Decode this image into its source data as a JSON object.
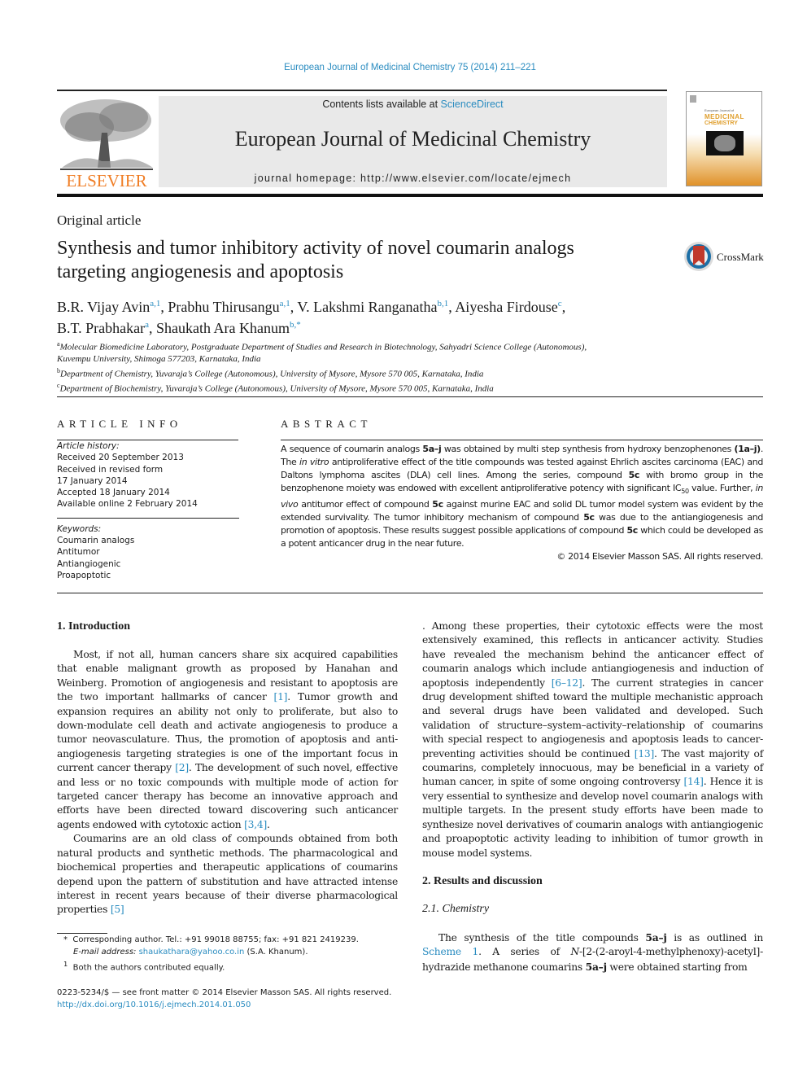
{
  "header": {
    "journal_ref": "European Journal of Medicinal Chemistry 75 (2014) 211–221",
    "contents_prefix": "Contents lists available at ",
    "contents_link": "ScienceDirect",
    "journal_title": "European Journal of Medicinal Chemistry",
    "homepage": "journal homepage: http://www.elsevier.com/locate/ejmech",
    "publisher_logo": "ELSEVIER",
    "cover": {
      "line1": "European Journal of",
      "line2": "MEDICINAL",
      "line3": "CHEMISTRY"
    },
    "brand_color": "#f07e26",
    "link_color": "#2a8cc0"
  },
  "article": {
    "type": "Original article",
    "title_line1": "Synthesis and tumor inhibitory activity of novel coumarin analogs",
    "title_line2": "targeting angiogenesis and apoptosis",
    "crossmark_label": "CrossMark",
    "authors": [
      {
        "name": "B.R. Vijay Avin",
        "sup": "a,1",
        "sep": ", "
      },
      {
        "name": "Prabhu Thirusangu",
        "sup": "a,1",
        "sep": ", "
      },
      {
        "name": "V. Lakshmi Ranganatha",
        "sup": "b,1",
        "sep": ", "
      },
      {
        "name": "Aiyesha Firdouse",
        "sup": "c",
        "sep": ","
      },
      {
        "name": "B.T. Prabhakar",
        "sup": "a",
        "sep": ", "
      },
      {
        "name": "Shaukath Ara Khanum",
        "sup": "b,*",
        "sep": ""
      }
    ],
    "affiliations": [
      {
        "key": "a",
        "line1": "Molecular Biomedicine Laboratory, Postgraduate Department of Studies and Research in Biotechnology, Sahyadri Science College (Autonomous),",
        "line2": "Kuvempu University, Shimoga 577203, Karnataka, India"
      },
      {
        "key": "b",
        "line1": "Department of Chemistry, Yuvaraja’s College (Autonomous), University of Mysore, Mysore 570 005, Karnataka, India"
      },
      {
        "key": "c",
        "line1": "Department of Biochemistry, Yuvaraja’s College (Autonomous), University of Mysore, Mysore 570 005, Karnataka, India"
      }
    ]
  },
  "article_info": {
    "heading": "ARTICLE INFO",
    "history_label": "Article history:",
    "history": [
      "Received 20 September 2013",
      "Received in revised form",
      "17 January 2014",
      "Accepted 18 January 2014",
      "Available online 2 February 2014"
    ],
    "keywords_label": "Keywords:",
    "keywords": [
      "Coumarin analogs",
      "Antitumor",
      "Antiangiogenic",
      "Proapoptotic"
    ]
  },
  "abstract": {
    "heading": "ABSTRACT",
    "s1a": "A sequence of coumarin analogs ",
    "b1": "5a–j",
    "s1b": " was obtained by multi step synthesis from hydroxy benzophenones ",
    "b2": "(1a–j)",
    "s2a": ". The ",
    "i1": "in vitro",
    "s2b": " antiproliferative effect of the title compounds was tested against Ehrlich ascites carcinoma (EAC) and Daltons lymphoma ascites (DLA) cell lines. Among the series, compound ",
    "b3": "5c",
    "s3": " with bromo group in the benzophenone moiety was endowed with excellent antiproliferative potency with significant IC",
    "sub50": "50",
    "s4a": " value. Further, ",
    "i2": "in vivo",
    "s4b": " antitumor effect of compound ",
    "b4": "5c",
    "s5": " against murine EAC and solid DL tumor model system was evident by the extended survivality. The tumor inhibitory mechanism of compound ",
    "b5": "5c",
    "s6": " was due to the antiangiogenesis and promotion of apoptosis. These results suggest possible applications of compound ",
    "b6": "5c",
    "s7": " which could be developed as a potent anticancer drug in the near future.",
    "copyright": "© 2014 Elsevier Masson SAS. All rights reserved."
  },
  "body": {
    "intro_heading": "1.  Introduction",
    "p1a": "Most, if not all, human cancers share six acquired capabilities that enable malignant growth as proposed by Hanahan and Weinberg. Promotion of angiogenesis and resistant to apoptosis are the two important hallmarks of cancer ",
    "c1": "[1]",
    "p1b": ". Tumor growth and expansion requires an ability not only to proliferate, but also to down-modulate cell death and activate angiogenesis to produce a tumor neovasculature. Thus, the promotion of apoptosis and anti-angiogenesis targeting strategies is one of the important focus in current cancer therapy ",
    "c2": "[2]",
    "p1c": ". The development of such novel, effective and less or no toxic compounds with multiple mode of action for targeted cancer therapy has become an innovative approach and efforts have been directed toward discovering such anticancer agents endowed with cytotoxic action ",
    "c3": "[3,4]",
    "p1d": ".",
    "p2a": "Coumarins are an old class of compounds obtained from both natural products and synthetic methods. The pharmacological and biochemical properties and therapeutic applications of coumarins depend upon the pattern of substitution and have attracted intense interest in recent years because of their diverse pharmacological properties ",
    "c4": "[5]",
    "p2b": ". Among these properties, their cytotoxic effects were the most extensively examined, this reflects in anticancer activity. Studies have revealed the mechanism behind the anticancer effect of coumarin analogs which include antiangiogenesis and induction of apoptosis independently ",
    "c5": "[6–12]",
    "p2c": ". The current strategies in cancer drug development shifted toward the multiple mechanistic approach and several drugs have been validated and developed. Such validation of structure–system–activity–relationship of coumarins with special respect to angiogenesis and apoptosis leads to cancer-preventing activities should be continued ",
    "c6": "[13]",
    "p2d": ". The vast majority of coumarins, completely innocuous, may be beneficial in a variety of human cancer, in spite of some ongoing controversy ",
    "c7": "[14]",
    "p2e": ". Hence it is very essential to synthesize and develop novel coumarin analogs with multiple targets. In the present study efforts have been made to synthesize novel derivatives of coumarin analogs with antiangiogenic and proapoptotic activity leading to inhibition of tumor growth in mouse model systems.",
    "results_heading": "2.  Results and discussion",
    "chem_heading": "2.1.  Chemistry",
    "p3a": "The synthesis of the title compounds ",
    "p3b1": "5a–j",
    "p3c": " is as outlined in ",
    "scheme_link": "Scheme 1",
    "p3d": ". A series of ",
    "p3n": "N",
    "p3e": "-[2-(2-aroyl-4-methylphenoxy)-acetyl]-hydrazide methanone coumarins ",
    "p3b2": "5a–j",
    "p3f": " were obtained starting from"
  },
  "footnotes": {
    "star": "*",
    "corresponding": "Corresponding author. Tel.: +91 99018 88755; fax: +91 821 2419239.",
    "email_label": "E-mail address: ",
    "email": "shaukathara@yahoo.co.in",
    "email_suffix": " (S.A. Khanum).",
    "one": "1",
    "equal": "Both the authors contributed equally."
  },
  "front_matter": {
    "issn": "0223-5234/$ — see front matter © 2014 Elsevier Masson SAS. All rights reserved.",
    "doi": "http://dx.doi.org/10.1016/j.ejmech.2014.01.050"
  }
}
